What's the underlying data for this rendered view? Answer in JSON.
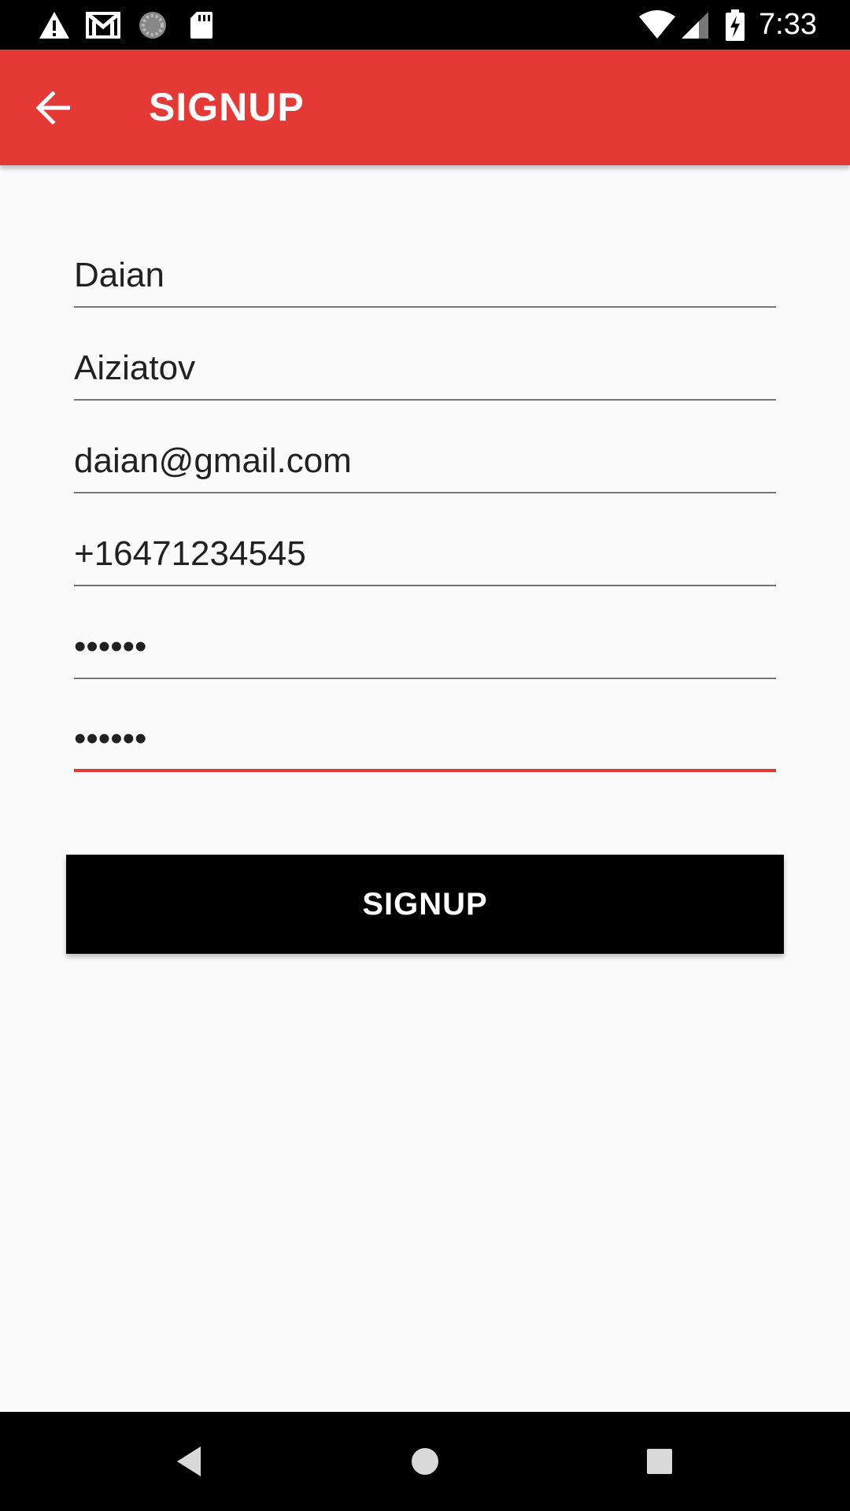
{
  "status_bar": {
    "time": "7:33",
    "left_icons": [
      "warning-icon",
      "gmail-icon",
      "sync-icon",
      "sd-card-icon"
    ],
    "right_icons": [
      "wifi-icon",
      "cell-signal-icon",
      "battery-charging-icon"
    ]
  },
  "app_bar": {
    "title": "SIGNUP",
    "back_icon": "arrow-back-icon",
    "color": "#e53935"
  },
  "form": {
    "first_name": "Daian",
    "last_name": "Aiziatov",
    "email": "daian@gmail.com",
    "phone": "+16471234545",
    "password": "••••••",
    "confirm_password": "••••••"
  },
  "signup_button": {
    "label": "SIGNUP"
  },
  "nav_bar": {
    "icons": [
      "nav-back-icon",
      "nav-home-icon",
      "nav-recents-icon"
    ]
  }
}
